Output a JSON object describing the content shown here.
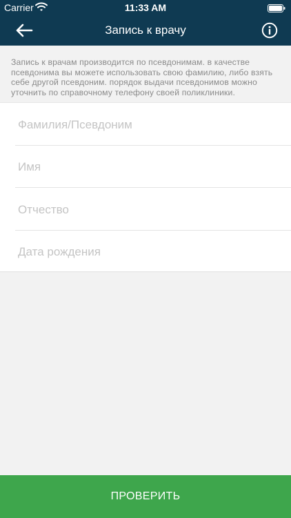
{
  "status_bar": {
    "carrier": "Carrier",
    "time": "11:33 AM",
    "wifi_icon": "wifi-icon",
    "battery_icon": "battery-icon"
  },
  "nav": {
    "title": "Запись к врачу",
    "back_icon": "arrow-left-icon",
    "info_icon": "info-icon"
  },
  "notice": {
    "text": "Запись к врачам производится по псевдонимам. в качестве псевдонима вы можете использовать свою фамилию, либо взять себе другой псевдоним. порядок выдачи псевдонимов можно уточнить по справочному телефону своей поликлиники."
  },
  "form": {
    "fields": [
      {
        "placeholder": "Фамилия/Псевдоним",
        "value": ""
      },
      {
        "placeholder": "Имя",
        "value": ""
      },
      {
        "placeholder": "Отчество",
        "value": ""
      },
      {
        "placeholder": "Дата рождения",
        "value": ""
      }
    ]
  },
  "submit": {
    "label": "ПРОВЕРИТЬ"
  },
  "colors": {
    "header": "#0f3a52",
    "accent": "#3ea64c",
    "background": "#f2f2f2"
  }
}
